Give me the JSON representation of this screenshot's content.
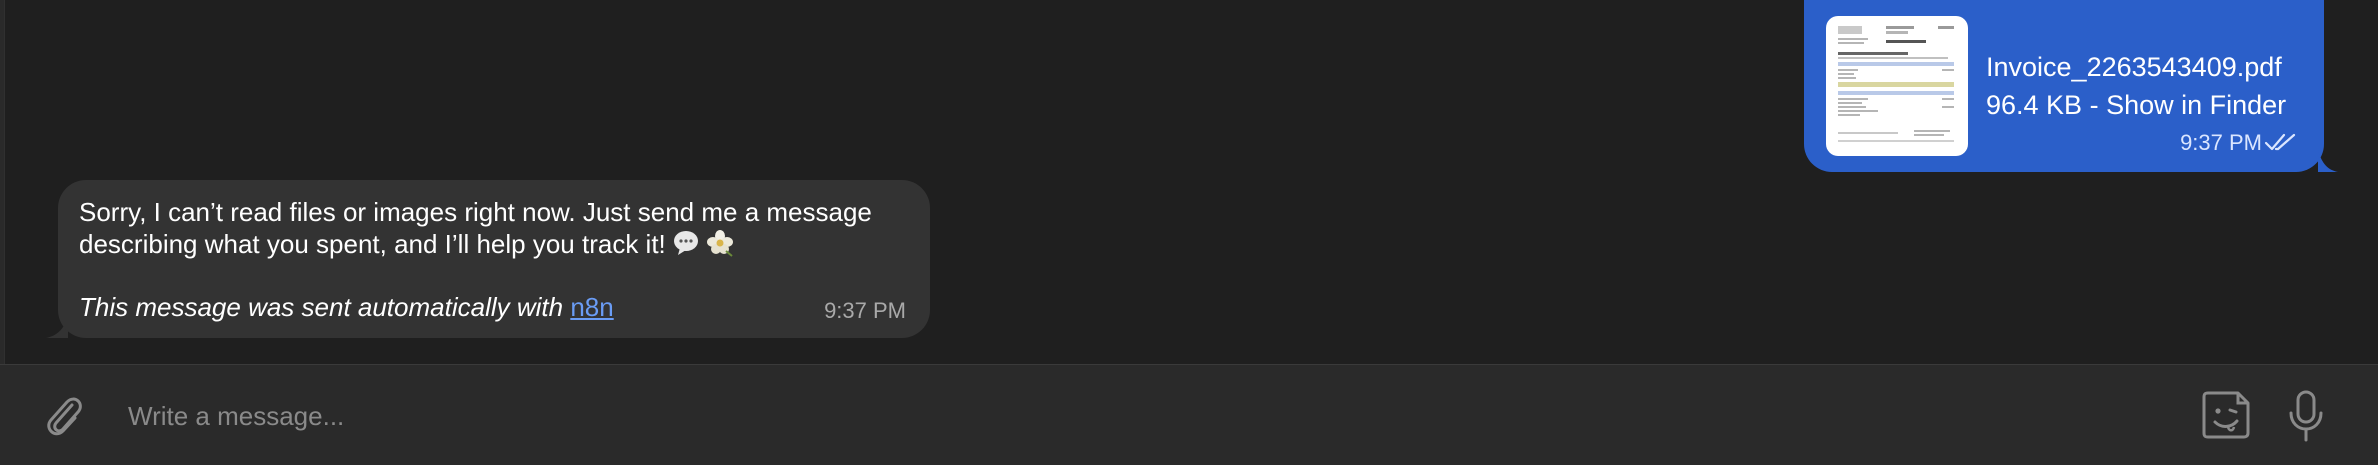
{
  "outgoing": {
    "file_name": "Invoice_2263543409.pdf",
    "file_meta": "96.4 KB - Show in Finder",
    "time": "9:37 PM",
    "status": "read"
  },
  "incoming": {
    "text": "Sorry, I can’t read files or images right now. Just send me a message describing what you spent, and I’ll help you track it!",
    "emojis": [
      "speech-balloon",
      "flower"
    ],
    "footer_prefix": "This message was sent automatically with ",
    "footer_link": "n8n",
    "time": "9:37 PM"
  },
  "composer": {
    "placeholder": "Write a message..."
  },
  "colors": {
    "background": "#1f1f1f",
    "outgoing_bubble": "#2b5fc9",
    "incoming_bubble": "#333333",
    "link": "#6a9cf5"
  }
}
